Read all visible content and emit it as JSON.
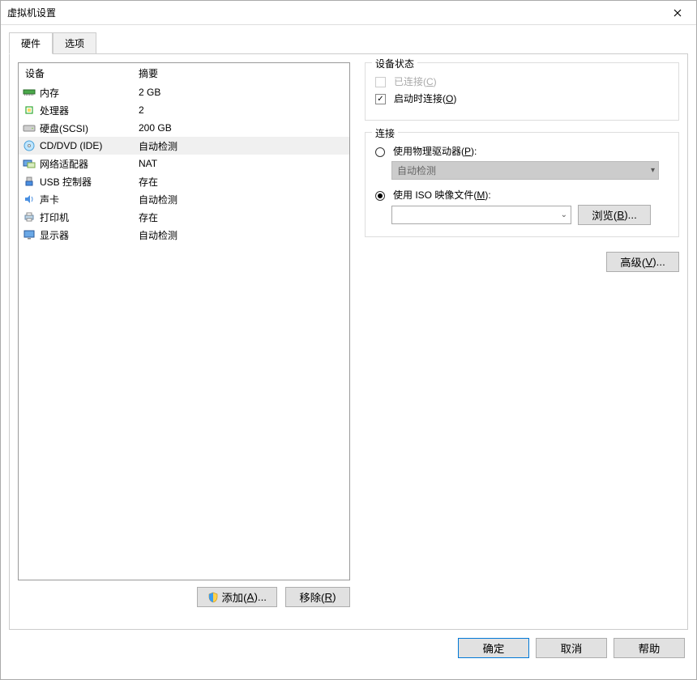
{
  "window": {
    "title": "虚拟机设置"
  },
  "tabs": {
    "hardware": "硬件",
    "options": "选项"
  },
  "list": {
    "header_device": "设备",
    "header_summary": "摘要",
    "items": [
      {
        "icon": "memory",
        "name": "内存",
        "summary": "2 GB"
      },
      {
        "icon": "cpu",
        "name": "处理器",
        "summary": "2"
      },
      {
        "icon": "disk",
        "name": "硬盘(SCSI)",
        "summary": "200 GB"
      },
      {
        "icon": "cd",
        "name": "CD/DVD (IDE)",
        "summary": "自动检测",
        "selected": true
      },
      {
        "icon": "net",
        "name": "网络适配器",
        "summary": "NAT"
      },
      {
        "icon": "usb",
        "name": "USB 控制器",
        "summary": "存在"
      },
      {
        "icon": "sound",
        "name": "声卡",
        "summary": "自动检测"
      },
      {
        "icon": "printer",
        "name": "打印机",
        "summary": "存在"
      },
      {
        "icon": "display",
        "name": "显示器",
        "summary": "自动检测"
      }
    ]
  },
  "buttons": {
    "add": "添加(",
    "add_u": "A",
    "add_suffix": ")...",
    "remove": "移除(",
    "remove_u": "R",
    "remove_suffix": ")"
  },
  "status_group": {
    "title": "设备状态",
    "connected": "已连接(",
    "connected_u": "C",
    "connected_suffix": ")",
    "connect_at_power": "启动时连接(",
    "connect_at_power_u": "O",
    "connect_at_power_suffix": ")"
  },
  "conn_group": {
    "title": "连接",
    "use_physical": "使用物理驱动器(",
    "use_physical_u": "P",
    "use_physical_suffix": "):",
    "auto_detect": "自动检测",
    "use_iso": "使用 ISO 映像文件(",
    "use_iso_u": "M",
    "use_iso_suffix": "):",
    "iso_value": "",
    "browse": "浏览(",
    "browse_u": "B",
    "browse_suffix": ")..."
  },
  "advanced": {
    "label": "高级(",
    "u": "V",
    "suffix": ")..."
  },
  "footer": {
    "ok": "确定",
    "cancel": "取消",
    "help": "帮助"
  }
}
